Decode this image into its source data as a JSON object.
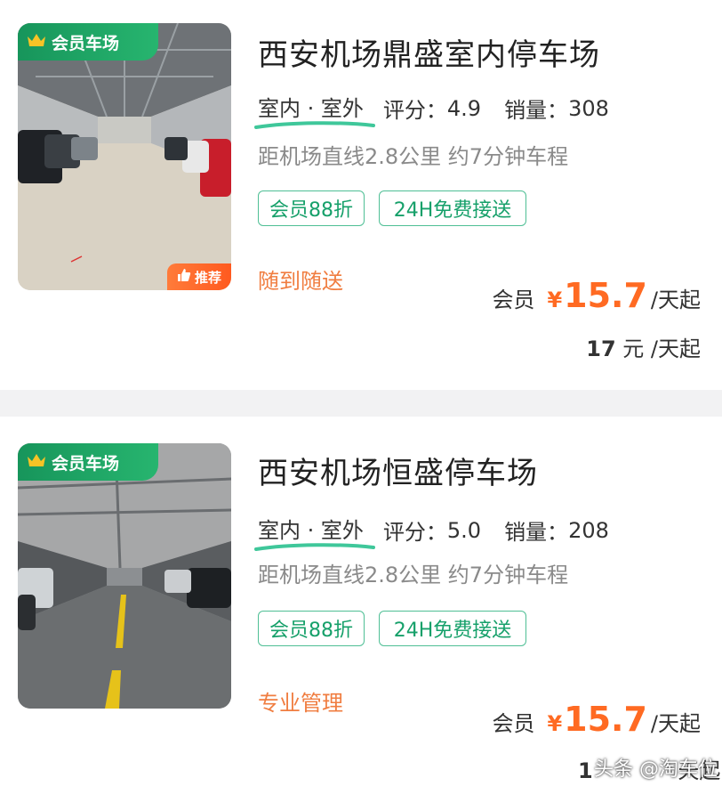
{
  "listings": [
    {
      "badge": "会员车场",
      "recommend": "推荐",
      "title": "西安机场鼎盛室内停车场",
      "location_type": "室内 · 室外",
      "score_label": "评分：",
      "score": "4.9",
      "sales_label": "销量：",
      "sales": "308",
      "distance": "距机场直线2.8公里 约7分钟车程",
      "tags": [
        "会员88折",
        "24H免费接送"
      ],
      "service": "随到随送",
      "member_label": "会员",
      "currency": "¥",
      "member_price": "15.7",
      "price_unit": "/天起",
      "original_price": "17",
      "original_unit": " 元 /天起"
    },
    {
      "badge": "会员车场",
      "title": "西安机场恒盛停车场",
      "location_type": "室内 · 室外",
      "score_label": "评分：",
      "score": "5.0",
      "sales_label": "销量：",
      "sales": "208",
      "distance": "距机场直线2.8公里 约7分钟车程",
      "tags": [
        "会员88折",
        "24H免费接送"
      ],
      "service": "专业管理",
      "member_label": "会员",
      "currency": "¥",
      "member_price": "15.7",
      "price_unit": "/天起",
      "original_price_partial": "1",
      "original_unit_partial": "天起"
    }
  ],
  "watermark": "头条 @淘车位",
  "colors": {
    "accent_green": "#16a06a",
    "price_orange": "#ff6a22",
    "service_orange": "#f07d40"
  },
  "icons": {
    "badge": "crown-icon",
    "recommend": "thumbs-up-icon"
  }
}
